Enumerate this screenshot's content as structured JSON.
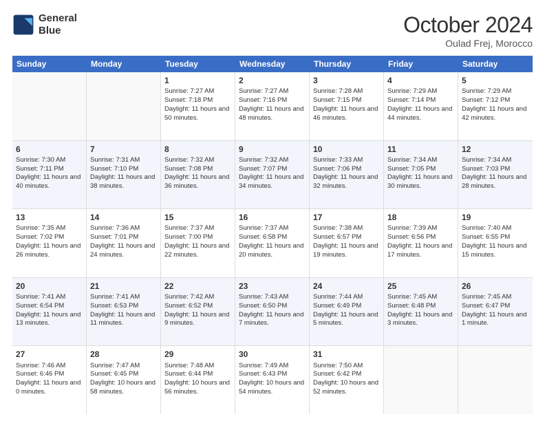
{
  "header": {
    "logo_line1": "General",
    "logo_line2": "Blue",
    "month": "October 2024",
    "location": "Oulad Frej, Morocco"
  },
  "weekdays": [
    "Sunday",
    "Monday",
    "Tuesday",
    "Wednesday",
    "Thursday",
    "Friday",
    "Saturday"
  ],
  "rows": [
    [
      {
        "day": "",
        "sunrise": "",
        "sunset": "",
        "daylight": "",
        "empty": true
      },
      {
        "day": "",
        "sunrise": "",
        "sunset": "",
        "daylight": "",
        "empty": true
      },
      {
        "day": "1",
        "sunrise": "Sunrise: 7:27 AM",
        "sunset": "Sunset: 7:18 PM",
        "daylight": "Daylight: 11 hours and 50 minutes."
      },
      {
        "day": "2",
        "sunrise": "Sunrise: 7:27 AM",
        "sunset": "Sunset: 7:16 PM",
        "daylight": "Daylight: 11 hours and 48 minutes."
      },
      {
        "day": "3",
        "sunrise": "Sunrise: 7:28 AM",
        "sunset": "Sunset: 7:15 PM",
        "daylight": "Daylight: 11 hours and 46 minutes."
      },
      {
        "day": "4",
        "sunrise": "Sunrise: 7:29 AM",
        "sunset": "Sunset: 7:14 PM",
        "daylight": "Daylight: 11 hours and 44 minutes."
      },
      {
        "day": "5",
        "sunrise": "Sunrise: 7:29 AM",
        "sunset": "Sunset: 7:12 PM",
        "daylight": "Daylight: 11 hours and 42 minutes."
      }
    ],
    [
      {
        "day": "6",
        "sunrise": "Sunrise: 7:30 AM",
        "sunset": "Sunset: 7:11 PM",
        "daylight": "Daylight: 11 hours and 40 minutes."
      },
      {
        "day": "7",
        "sunrise": "Sunrise: 7:31 AM",
        "sunset": "Sunset: 7:10 PM",
        "daylight": "Daylight: 11 hours and 38 minutes."
      },
      {
        "day": "8",
        "sunrise": "Sunrise: 7:32 AM",
        "sunset": "Sunset: 7:08 PM",
        "daylight": "Daylight: 11 hours and 36 minutes."
      },
      {
        "day": "9",
        "sunrise": "Sunrise: 7:32 AM",
        "sunset": "Sunset: 7:07 PM",
        "daylight": "Daylight: 11 hours and 34 minutes."
      },
      {
        "day": "10",
        "sunrise": "Sunrise: 7:33 AM",
        "sunset": "Sunset: 7:06 PM",
        "daylight": "Daylight: 11 hours and 32 minutes."
      },
      {
        "day": "11",
        "sunrise": "Sunrise: 7:34 AM",
        "sunset": "Sunset: 7:05 PM",
        "daylight": "Daylight: 11 hours and 30 minutes."
      },
      {
        "day": "12",
        "sunrise": "Sunrise: 7:34 AM",
        "sunset": "Sunset: 7:03 PM",
        "daylight": "Daylight: 11 hours and 28 minutes."
      }
    ],
    [
      {
        "day": "13",
        "sunrise": "Sunrise: 7:35 AM",
        "sunset": "Sunset: 7:02 PM",
        "daylight": "Daylight: 11 hours and 26 minutes."
      },
      {
        "day": "14",
        "sunrise": "Sunrise: 7:36 AM",
        "sunset": "Sunset: 7:01 PM",
        "daylight": "Daylight: 11 hours and 24 minutes."
      },
      {
        "day": "15",
        "sunrise": "Sunrise: 7:37 AM",
        "sunset": "Sunset: 7:00 PM",
        "daylight": "Daylight: 11 hours and 22 minutes."
      },
      {
        "day": "16",
        "sunrise": "Sunrise: 7:37 AM",
        "sunset": "Sunset: 6:58 PM",
        "daylight": "Daylight: 11 hours and 20 minutes."
      },
      {
        "day": "17",
        "sunrise": "Sunrise: 7:38 AM",
        "sunset": "Sunset: 6:57 PM",
        "daylight": "Daylight: 11 hours and 19 minutes."
      },
      {
        "day": "18",
        "sunrise": "Sunrise: 7:39 AM",
        "sunset": "Sunset: 6:56 PM",
        "daylight": "Daylight: 11 hours and 17 minutes."
      },
      {
        "day": "19",
        "sunrise": "Sunrise: 7:40 AM",
        "sunset": "Sunset: 6:55 PM",
        "daylight": "Daylight: 11 hours and 15 minutes."
      }
    ],
    [
      {
        "day": "20",
        "sunrise": "Sunrise: 7:41 AM",
        "sunset": "Sunset: 6:54 PM",
        "daylight": "Daylight: 11 hours and 13 minutes."
      },
      {
        "day": "21",
        "sunrise": "Sunrise: 7:41 AM",
        "sunset": "Sunset: 6:53 PM",
        "daylight": "Daylight: 11 hours and 11 minutes."
      },
      {
        "day": "22",
        "sunrise": "Sunrise: 7:42 AM",
        "sunset": "Sunset: 6:52 PM",
        "daylight": "Daylight: 11 hours and 9 minutes."
      },
      {
        "day": "23",
        "sunrise": "Sunrise: 7:43 AM",
        "sunset": "Sunset: 6:50 PM",
        "daylight": "Daylight: 11 hours and 7 minutes."
      },
      {
        "day": "24",
        "sunrise": "Sunrise: 7:44 AM",
        "sunset": "Sunset: 6:49 PM",
        "daylight": "Daylight: 11 hours and 5 minutes."
      },
      {
        "day": "25",
        "sunrise": "Sunrise: 7:45 AM",
        "sunset": "Sunset: 6:48 PM",
        "daylight": "Daylight: 11 hours and 3 minutes."
      },
      {
        "day": "26",
        "sunrise": "Sunrise: 7:45 AM",
        "sunset": "Sunset: 6:47 PM",
        "daylight": "Daylight: 11 hours and 1 minute."
      }
    ],
    [
      {
        "day": "27",
        "sunrise": "Sunrise: 7:46 AM",
        "sunset": "Sunset: 6:46 PM",
        "daylight": "Daylight: 11 hours and 0 minutes."
      },
      {
        "day": "28",
        "sunrise": "Sunrise: 7:47 AM",
        "sunset": "Sunset: 6:45 PM",
        "daylight": "Daylight: 10 hours and 58 minutes."
      },
      {
        "day": "29",
        "sunrise": "Sunrise: 7:48 AM",
        "sunset": "Sunset: 6:44 PM",
        "daylight": "Daylight: 10 hours and 56 minutes."
      },
      {
        "day": "30",
        "sunrise": "Sunrise: 7:49 AM",
        "sunset": "Sunset: 6:43 PM",
        "daylight": "Daylight: 10 hours and 54 minutes."
      },
      {
        "day": "31",
        "sunrise": "Sunrise: 7:50 AM",
        "sunset": "Sunset: 6:42 PM",
        "daylight": "Daylight: 10 hours and 52 minutes."
      },
      {
        "day": "",
        "sunrise": "",
        "sunset": "",
        "daylight": "",
        "empty": true
      },
      {
        "day": "",
        "sunrise": "",
        "sunset": "",
        "daylight": "",
        "empty": true
      }
    ]
  ]
}
